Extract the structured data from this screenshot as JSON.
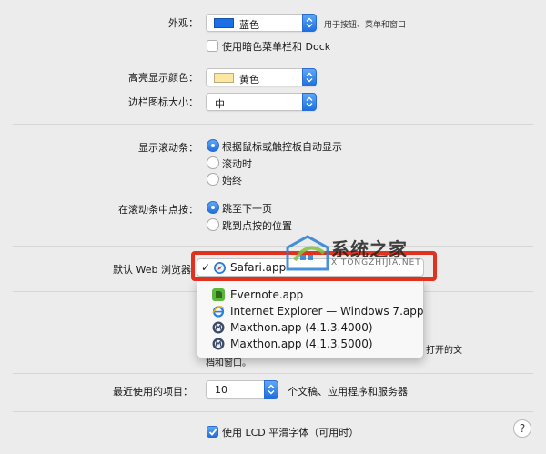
{
  "appearance": {
    "label": "外观：",
    "value": "蓝色",
    "swatch_color": "#1d6fe5",
    "note": "用于按钮、菜单和窗口",
    "dark_menu_label": "使用暗色菜单栏和 Dock",
    "dark_menu_checked": false
  },
  "highlight_color": {
    "label": "高亮显示颜色：",
    "value": "黄色",
    "swatch_color": "#fbe7a3"
  },
  "sidebar_icon_size": {
    "label": "边栏图标大小：",
    "value": "中"
  },
  "scroll_bars": {
    "label": "显示滚动条：",
    "options": [
      {
        "label": "根据鼠标或触控板自动显示",
        "selected": true
      },
      {
        "label": "滚动时",
        "selected": false
      },
      {
        "label": "始终",
        "selected": false
      }
    ]
  },
  "scroll_click": {
    "label": "在滚动条中点按：",
    "options": [
      {
        "label": "跳至下一页",
        "selected": true
      },
      {
        "label": "跳到点按的位置",
        "selected": false
      }
    ]
  },
  "default_browser": {
    "label": "默认 Web 浏览器",
    "selected": "Safari.app",
    "menu_items": [
      {
        "label": "Evernote.app",
        "icon": "evernote-icon"
      },
      {
        "label": "Internet Explorer — Windows 7.app",
        "icon": "internet-explorer-icon"
      },
      {
        "label": "Maxthon.app (4.1.3.4000)",
        "icon": "maxthon-icon"
      },
      {
        "label": "Maxthon.app (4.1.3.5000)",
        "icon": "maxthon-icon"
      }
    ],
    "partial_text_line1": "打开的文",
    "partial_text_line2": "档和窗口。"
  },
  "recent_items": {
    "label": "最近使用的项目：",
    "value": "10",
    "suffix": "个文稿、应用程序和服务器"
  },
  "lcd_font": {
    "label": "使用 LCD 平滑字体（可用时）",
    "checked": true
  },
  "help_label": "?",
  "watermark": {
    "title": "系统之家",
    "url": "XITONGZHIJIA.NET"
  },
  "colors": {
    "accent": "#1f6fe0",
    "highlight_border": "#e0321f",
    "background": "#ececec"
  }
}
